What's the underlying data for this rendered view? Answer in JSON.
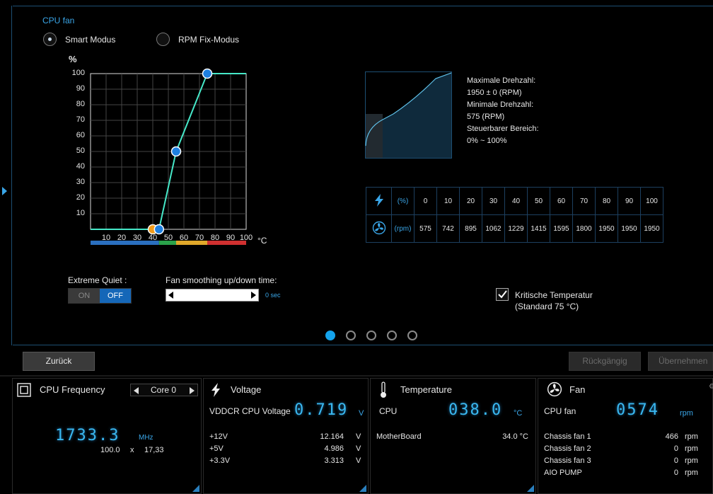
{
  "fan_section": {
    "title": "CPU fan",
    "mode_smart": "Smart Modus",
    "mode_rpm_fix": "RPM Fix-Modus",
    "selected_mode": "Smart Modus"
  },
  "curve": {
    "y_unit": "%",
    "x_unit": "°C",
    "y_ticks": [
      "100",
      "90",
      "80",
      "70",
      "60",
      "50",
      "40",
      "30",
      "20",
      "10"
    ],
    "x_ticks": [
      "10",
      "20",
      "30",
      "40",
      "50",
      "60",
      "70",
      "80",
      "90",
      "100"
    ],
    "points": [
      {
        "temp": 40,
        "percent": 0,
        "color": "#f29b1a"
      },
      {
        "temp": 44,
        "percent": 0,
        "color": "#1e7fe0"
      },
      {
        "temp": 55,
        "percent": 50,
        "color": "#1e7fe0"
      },
      {
        "temp": 75,
        "percent": 100,
        "color": "#1e7fe0"
      }
    ],
    "line_color": "#46e8c8",
    "zone_colors": [
      "#2a6fbf",
      "#2aa24a",
      "#e0a82a",
      "#d03030"
    ]
  },
  "fan_info": {
    "max_label": "Maximale Drehzahl:",
    "max_value": "1950 ± 0 (RPM)",
    "min_label": "Minimale Drehzahl:",
    "min_value": "575 (RPM)",
    "range_label": "Steuerbarer Bereich:",
    "range_value": "0% ~ 100%"
  },
  "rpm_table": {
    "percent_unit": "(%)",
    "rpm_unit": "(rpm)",
    "percents": [
      "0",
      "10",
      "20",
      "30",
      "40",
      "50",
      "60",
      "70",
      "80",
      "90",
      "100"
    ],
    "rpms": [
      "575",
      "742",
      "895",
      "1062",
      "1229",
      "1415",
      "1595",
      "1800",
      "1950",
      "1950",
      "1950"
    ]
  },
  "extreme_quiet": {
    "label": "Extreme Quiet :",
    "on": "ON",
    "off": "OFF",
    "state": "OFF"
  },
  "smoothing": {
    "label": "Fan smoothing up/down time:",
    "value": "0 sec"
  },
  "critical_temp": {
    "label": "Kritische Temperatur",
    "sub": "(Standard 75 °C)",
    "checked": true
  },
  "pager": {
    "count": 5,
    "active": 0
  },
  "footer": {
    "back": "Zurück",
    "undo": "Rückgängig",
    "apply": "Übernehmen"
  },
  "cpu_freq": {
    "title": "CPU Frequency",
    "core": "Core 0",
    "value": "1733.3",
    "unit": "MHz",
    "base": "100.0",
    "x": "x",
    "multiplier": "17,33"
  },
  "voltage": {
    "title": "Voltage",
    "main_label": "VDDCR CPU Voltage",
    "main_value": "0.719",
    "main_unit": "V",
    "rows": [
      {
        "name": "+12V",
        "value": "12.164",
        "unit": "V"
      },
      {
        "name": "+5V",
        "value": "4.986",
        "unit": "V"
      },
      {
        "name": "+3.3V",
        "value": "3.313",
        "unit": "V"
      }
    ]
  },
  "temperature": {
    "title": "Temperature",
    "main_label": "CPU",
    "main_value": "038.0",
    "main_unit": "°C",
    "rows": [
      {
        "name": "MotherBoard",
        "value": "34.0 °C"
      }
    ]
  },
  "fan": {
    "title": "Fan",
    "main_label": "CPU fan",
    "main_value": "0574",
    "main_unit": "rpm",
    "rows": [
      {
        "name": "Chassis fan 1",
        "value": "466",
        "unit": "rpm"
      },
      {
        "name": "Chassis fan 2",
        "value": "0",
        "unit": "rpm"
      },
      {
        "name": "Chassis fan 3",
        "value": "0",
        "unit": "rpm"
      },
      {
        "name": "AIO PUMP",
        "value": "0",
        "unit": "rpm"
      }
    ]
  }
}
